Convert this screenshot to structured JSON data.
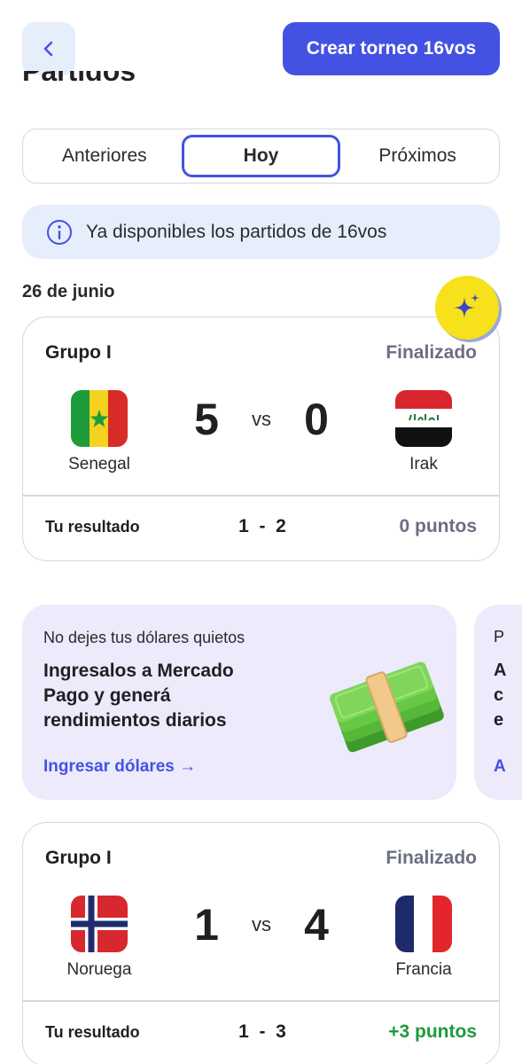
{
  "header": {
    "back_icon": "chevron-left-icon",
    "create_button": "Crear torneo 16vos",
    "section_title": "Partidos"
  },
  "tabs": [
    {
      "label": "Anteriores",
      "active": false
    },
    {
      "label": "Hoy",
      "active": true
    },
    {
      "label": "Próximos",
      "active": false
    }
  ],
  "info_banner": {
    "icon": "info-icon",
    "text": "Ya disponibles los partidos de 16vos"
  },
  "date_label": "26 de junio",
  "fab_icon": "sparkle-icon",
  "matches": [
    {
      "group": "Grupo I",
      "status": "Finalizado",
      "home_team": "Senegal",
      "home_score": "5",
      "vs": "vs",
      "away_team": "Irak",
      "away_score": "0",
      "your_result_label": "Tu resultado",
      "your_result": "1  -  2",
      "points": "0 puntos",
      "points_color": "#6b6f82"
    },
    {
      "group": "Grupo I",
      "status": "Finalizado",
      "home_team": "Noruega",
      "home_score": "1",
      "vs": "vs",
      "away_team": "Francia",
      "away_score": "4",
      "your_result_label": "Tu resultado",
      "your_result": "1  -  3",
      "points": "+3 puntos",
      "points_color": "#1f9a3a"
    }
  ],
  "promo": {
    "eyebrow": "No dejes tus dólares quietos",
    "headline": "Ingresalos a Mercado Pago y generá rendimientos diarios",
    "link": "Ingresar dólares →",
    "image_icon": "money-stack-icon"
  },
  "promo_peek": {
    "eyebrow_letter": "P",
    "letters": [
      "A",
      "c",
      "e"
    ],
    "link_letter": "A"
  },
  "colors": {
    "accent": "#4452e3",
    "info_bg": "#e6eefc",
    "promo_bg": "#eceafb",
    "fab": "#f6e11c"
  }
}
